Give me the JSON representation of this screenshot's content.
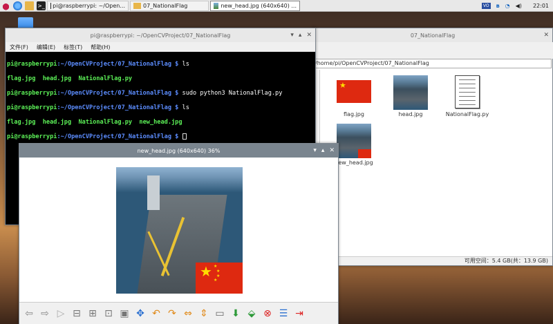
{
  "taskbar": {
    "tasks": [
      {
        "label": "pi@raspberrypi: ~/Open..."
      },
      {
        "label": "07_NationalFlag"
      },
      {
        "label": "new_head.jpg (640x640) ..."
      }
    ],
    "clock": "22:01",
    "volume": "VO"
  },
  "file_manager": {
    "title": "07_NationalFlag",
    "path": "/home/pi/OpenCVProject/07_NationalFlag",
    "status": "可用空间：5.4 GB(共：13.9 GB)",
    "files": [
      {
        "name": "flag.jpg",
        "icon": "flag-thumbnail"
      },
      {
        "name": "head.jpg",
        "icon": "carrier-thumbnail"
      },
      {
        "name": "NationalFlag.py",
        "icon": "text-file-icon"
      },
      {
        "name": "new_head.jpg",
        "icon": "carrier-flag-thumbnail"
      }
    ]
  },
  "terminal": {
    "title": "pi@raspberrypi: ~/OpenCVProject/07_NationalFlag",
    "menu": [
      "文件(F)",
      "编辑(E)",
      "标签(T)",
      "帮助(H)"
    ],
    "prompt_user": "pi@raspberrypi",
    "prompt_path": ":~/OpenCVProject/07_NationalFlag $",
    "lines": [
      {
        "cmd": " ls"
      },
      {
        "out": "flag.jpg  head.jpg  NationalFlag.py"
      },
      {
        "cmd": " sudo python3 NationalFlag.py"
      },
      {
        "cmd": " ls"
      },
      {
        "out": "flag.jpg  head.jpg  NationalFlag.py  new_head.jpg"
      },
      {
        "cmd": " "
      }
    ]
  },
  "viewer": {
    "title": "new_head.jpg (640x640) 36%"
  },
  "colors": {
    "flag_red": "#de2910",
    "flag_yellow": "#ffde00",
    "sea": "#2d5878",
    "titlebar": "#7a858f"
  }
}
